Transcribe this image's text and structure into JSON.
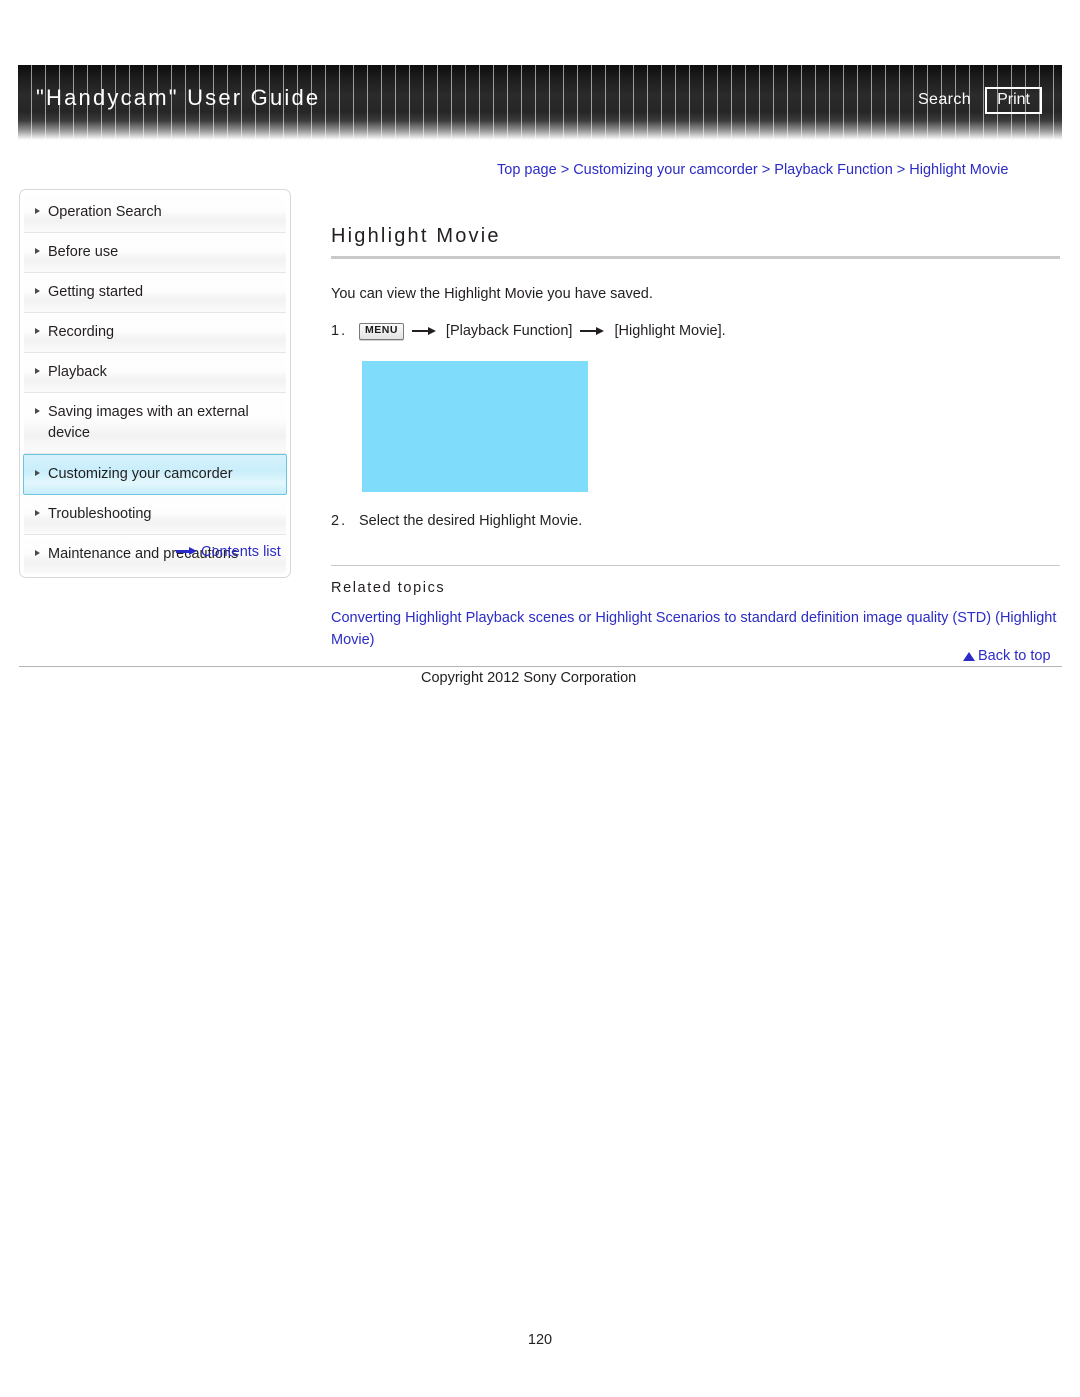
{
  "header": {
    "title": "\"Handycam\" User Guide",
    "search_label": "Search",
    "print_label": "Print"
  },
  "breadcrumb": {
    "items": [
      "Top page",
      "Customizing your camcorder",
      "Playback Function",
      "Highlight Movie"
    ],
    "separator": ">",
    "full_text": "Top page > Customizing your camcorder > Playback Function > Highlight Movie"
  },
  "sidebar": {
    "items": [
      {
        "label": "Operation Search",
        "active": false
      },
      {
        "label": "Before use",
        "active": false
      },
      {
        "label": "Getting started",
        "active": false
      },
      {
        "label": "Recording",
        "active": false
      },
      {
        "label": "Playback",
        "active": false
      },
      {
        "label": "Saving images with an external device",
        "active": false
      },
      {
        "label": "Customizing your camcorder",
        "active": true
      },
      {
        "label": "Troubleshooting",
        "active": false
      },
      {
        "label": "Maintenance and precautions",
        "active": false
      }
    ],
    "contents_list_label": "Contents list"
  },
  "main": {
    "heading": "Highlight Movie",
    "intro": "You can view the Highlight Movie you have saved.",
    "steps": [
      {
        "number": "1.",
        "menu_chip": "MENU",
        "parts": [
          "[Playback Function]",
          "[Highlight Movie]."
        ]
      },
      {
        "number": "2.",
        "text": "Select the desired Highlight Movie."
      }
    ],
    "related_heading": "Related topics",
    "related_link": "Converting Highlight Playback scenes or Highlight Scenarios to standard definition image quality (STD) (Highlight Movie)",
    "back_to_top": "Back to top"
  },
  "footer": {
    "copyright": "Copyright 2012 Sony Corporation",
    "page_number": "120"
  },
  "colors": {
    "link": "#2b2bc8",
    "figure_placeholder": "#7fdcfb",
    "active_nav_border": "#6cc6e0",
    "text": "#231f20"
  },
  "icons": {
    "nav_bullet": "triangle-right-icon",
    "contents_arrow": "arrow-right-icon",
    "step_arrow": "arrow-right-icon",
    "back_to_top": "triangle-up-icon"
  }
}
